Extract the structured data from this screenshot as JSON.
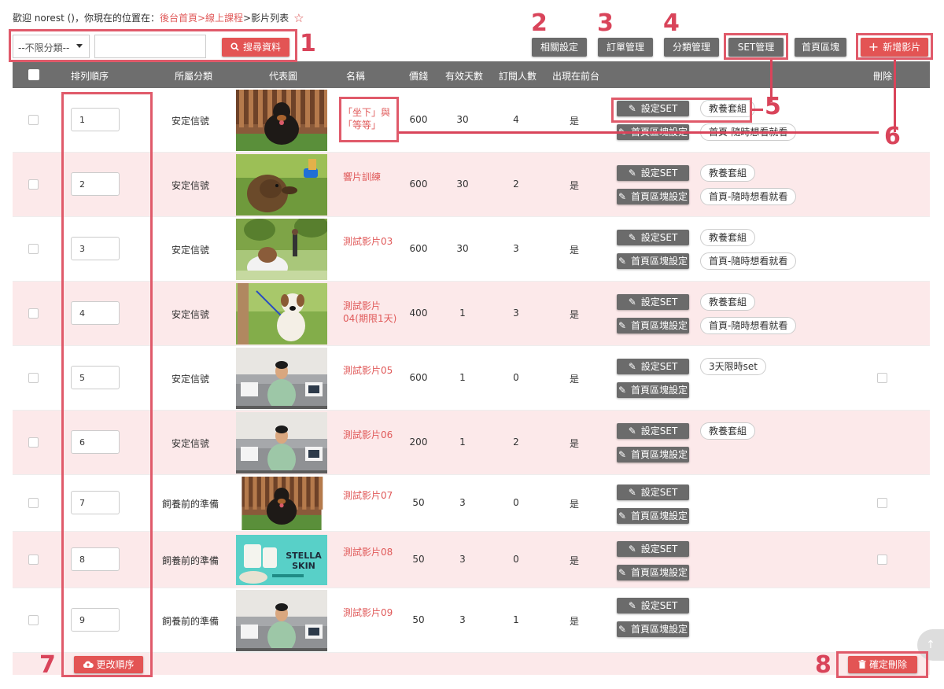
{
  "breadcrumb": {
    "welcome": "歡迎 norest ()，你現在的位置在：",
    "crumbs": [
      "後台首頁",
      "線上課程",
      "影片列表"
    ],
    "sep": ">"
  },
  "filter": {
    "category_selected": "--不限分類--",
    "search_value": "",
    "search_button": "搜尋資料"
  },
  "toolbar": {
    "related_settings": "相關設定",
    "orders": "訂單管理",
    "categories": "分類管理",
    "set_manage": "SET管理",
    "home_blocks": "首頁區塊",
    "add_video": "新增影片"
  },
  "table": {
    "headers": [
      "排列順序",
      "所屬分類",
      "代表圖",
      "名稱",
      "價錢",
      "有效天數",
      "訂閱人數",
      "出現在前台",
      "刪除"
    ],
    "set_btn": "設定SET",
    "home_btn": "首頁區塊設定",
    "rows": [
      {
        "order": "1",
        "category": "安定信號",
        "name": "「坐下」與「等等」",
        "price": "600",
        "days": "30",
        "subs": "4",
        "visible": "是",
        "tags": [
          "教養套組",
          "首頁-隨時想看就看"
        ],
        "delete": false,
        "img": "dog_fence"
      },
      {
        "order": "2",
        "category": "安定信號",
        "name": "響片訓練",
        "price": "600",
        "days": "30",
        "subs": "2",
        "visible": "是",
        "tags": [
          "教養套組",
          "首頁-隨時想看就看"
        ],
        "delete": false,
        "img": "dog_clicker"
      },
      {
        "order": "3",
        "category": "安定信號",
        "name": "測試影片03",
        "price": "600",
        "days": "30",
        "subs": "3",
        "visible": "是",
        "tags": [
          "教養套組",
          "首頁-隨時想看就看"
        ],
        "delete": false,
        "img": "dog_park"
      },
      {
        "order": "4",
        "category": "安定信號",
        "name": "測試影片04(期限1天)",
        "price": "400",
        "days": "1",
        "subs": "3",
        "visible": "是",
        "tags": [
          "教養套組",
          "首頁-隨時想看就看"
        ],
        "delete": false,
        "img": "dog_sit"
      },
      {
        "order": "5",
        "category": "安定信號",
        "name": "測試影片05",
        "price": "600",
        "days": "1",
        "subs": "0",
        "visible": "是",
        "tags": [
          "3天限時set"
        ],
        "delete": true,
        "img": "man_sofa"
      },
      {
        "order": "6",
        "category": "安定信號",
        "name": "測試影片06",
        "price": "200",
        "days": "1",
        "subs": "2",
        "visible": "是",
        "tags": [
          "教養套組"
        ],
        "delete": false,
        "img": "man_sofa"
      },
      {
        "order": "7",
        "category": "飼養前的準備",
        "name": "測試影片07",
        "price": "50",
        "days": "3",
        "subs": "0",
        "visible": "是",
        "tags": [],
        "delete": true,
        "img": "dog_fence"
      },
      {
        "order": "8",
        "category": "飼養前的準備",
        "name": "測試影片08",
        "price": "50",
        "days": "3",
        "subs": "0",
        "visible": "是",
        "tags": [],
        "delete": true,
        "img": "stella"
      },
      {
        "order": "9",
        "category": "飼養前的準備",
        "name": "測試影片09",
        "price": "50",
        "days": "3",
        "subs": "1",
        "visible": "是",
        "tags": [],
        "delete": false,
        "img": "man_sofa"
      }
    ]
  },
  "footer": {
    "update_order": "更改順序",
    "confirm_delete": "確定刪除"
  },
  "stella_text": [
    "STELLA",
    "SKIN"
  ],
  "annotations": [
    "1",
    "2",
    "3",
    "4",
    "5",
    "6",
    "7",
    "8"
  ],
  "colors": {
    "accent": "#e35454",
    "header": "#6e6e6e",
    "pink_row": "#fce9ea",
    "annotation": "#d9445a"
  }
}
